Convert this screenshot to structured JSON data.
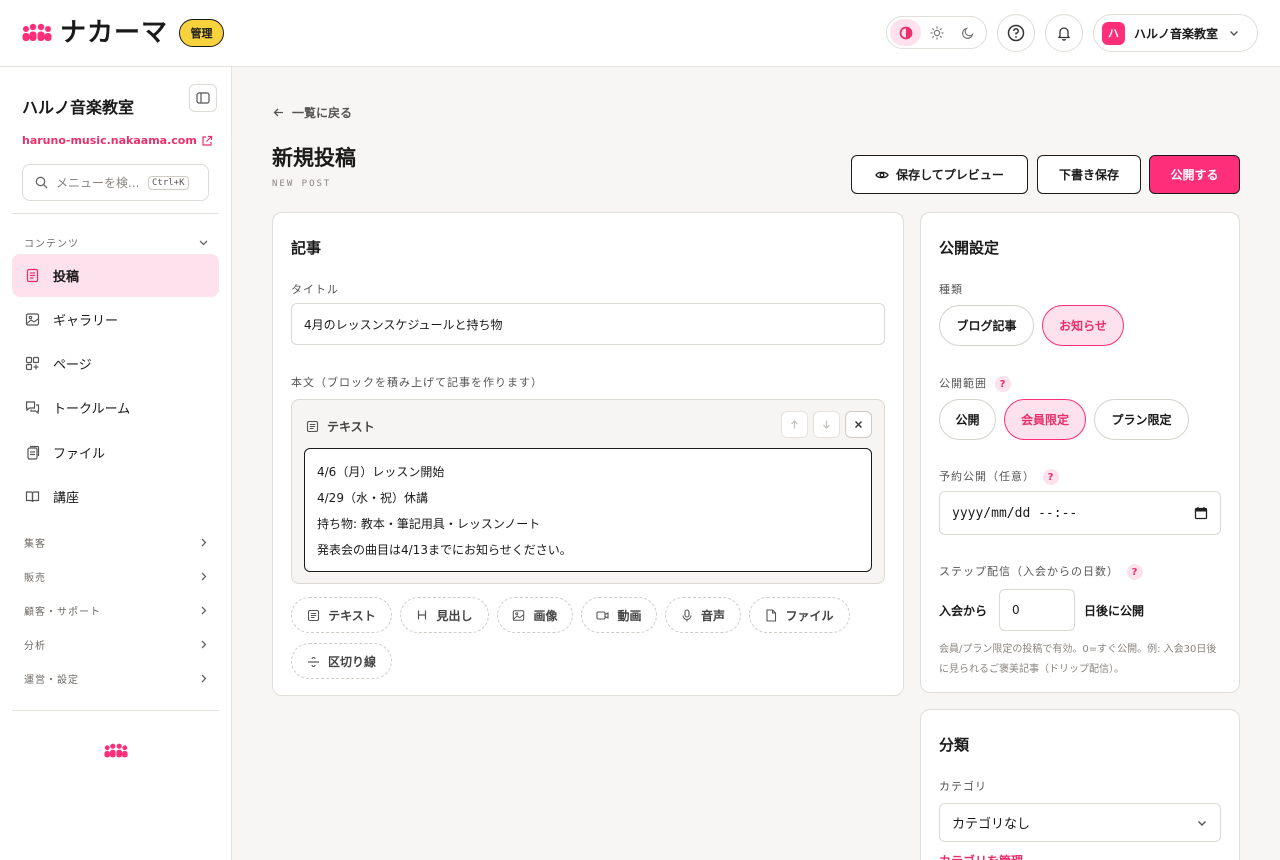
{
  "brand": {
    "logo_text": "ナカーマ",
    "admin_badge": "管理",
    "accent": "#ff2e7a"
  },
  "topbar": {
    "theme_modes": [
      "contrast-icon",
      "sun-icon",
      "moon-icon"
    ],
    "account_initial": "ハ",
    "account_name": "ハルノ音楽教室"
  },
  "sidebar": {
    "site_name": "ハルノ音楽教室",
    "site_url": "haruno-music.nakaama.com",
    "search_placeholder": "メニューを検...",
    "search_shortcut": "Ctrl+K",
    "content_section": "コンテンツ",
    "items": [
      {
        "label": "投稿",
        "icon": "document-icon",
        "active": true
      },
      {
        "label": "ギャラリー",
        "icon": "image-icon"
      },
      {
        "label": "ページ",
        "icon": "pages-plus-icon"
      },
      {
        "label": "トークルーム",
        "icon": "chat-icon"
      },
      {
        "label": "ファイル",
        "icon": "files-icon"
      },
      {
        "label": "講座",
        "icon": "book-icon"
      }
    ],
    "sections": [
      "集客",
      "販売",
      "顧客・サポート",
      "分析",
      "運営・設定"
    ]
  },
  "main": {
    "back_link": "一覧に戻る",
    "title": "新規投稿",
    "subtitle": "NEW POST",
    "buttons": {
      "preview": "保存してプレビュー",
      "draft": "下書き保存",
      "publish": "公開する"
    }
  },
  "article": {
    "card_title": "記事",
    "title_label": "タイトル",
    "title_value": "4月のレッスンスケジュールと持ち物",
    "body_label": "本文（ブロックを積み上げて記事を作ります）",
    "block_type": "テキスト",
    "block_lines": [
      "4/6（月）レッスン開始",
      "4/29（水・祝）休講",
      "持ち物: 教本・筆記用具・レッスンノート",
      "発表会の曲目は4/13までにお知らせください。"
    ],
    "add_blocks": [
      "テキスト",
      "見出し",
      "画像",
      "動画",
      "音声",
      "ファイル",
      "区切り線"
    ]
  },
  "publish": {
    "card_title": "公開設定",
    "type_label": "種類",
    "types": [
      "ブログ記事",
      "お知らせ"
    ],
    "type_selected": "お知らせ",
    "scope_label": "公開範囲",
    "scopes": [
      "公開",
      "会員限定",
      "プラン限定"
    ],
    "scope_selected": "会員限定",
    "schedule_label": "予約公開（任意）",
    "schedule_placeholder": "yyyy/mm/dd --:--",
    "step_label": "ステップ配信（入会からの日数）",
    "step_prefix": "入会から",
    "step_value": "0",
    "step_suffix": "日後に公開",
    "step_note": "会員/プラン限定の投稿で有効。0=すぐ公開。例: 入会30日後に見られるご褒美記事（ドリップ配信）。",
    "help_mark": "?"
  },
  "classify": {
    "card_title": "分類",
    "category_label": "カテゴリ",
    "category_value": "カテゴリなし",
    "manage_link": "カテゴリを管理"
  }
}
